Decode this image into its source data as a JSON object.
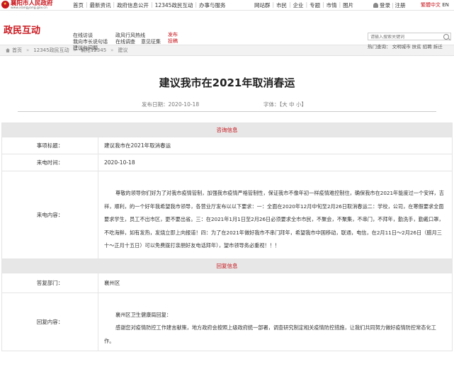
{
  "site": {
    "logo_cn": "襄阳市人民政府",
    "logo_url": "www.xiangyang.gov.cn"
  },
  "topnav": [
    "首页",
    "最新资讯",
    "政府信息公开",
    "12345政民互动",
    "办事与服务"
  ],
  "toplinks": [
    "网站群",
    "市民",
    "企业",
    "专题",
    "市情",
    "图片"
  ],
  "login": {
    "login": "登录",
    "register": "注册"
  },
  "lang": {
    "active": "繁體中文",
    "en": "EN"
  },
  "brand": "政民互动",
  "subnav": {
    "row1": [
      "在线访谈",
      "政风行风热线"
    ],
    "row2": [
      "我向市长说句话",
      "在线调查",
      "意见征集"
    ],
    "row3": [
      "建议与问题"
    ]
  },
  "hot": [
    "发布",
    "投稿"
  ],
  "search": {
    "placeholder": "请输入搜索关键词"
  },
  "hotwords": "热门查询：  文明城市 扶贫 招聘 拆迁",
  "breadcrumb": [
    "首页",
    "12345政民互动",
    "襄阳12345",
    "建议"
  ],
  "page_title": "建议我市在2021年取消春运",
  "meta": {
    "date": "发布日期：2020-10-18",
    "font": "字体：【大 中 小】"
  },
  "consult": {
    "section": "咨询信息",
    "subject_label": "事项标题：",
    "subject": "建议我市在2021年取消春运",
    "time_label": "来电时间：",
    "time": "2020-10-18",
    "content_label": "来电内容：",
    "content": "尊敬的领导你们好为了对我市疫情管制，加强我市疫情严格管制性，保证我市不像年初一样疫情难控制住，确保我市在2021年能度过一个安祥，吉祥，顺利，的一个好年我希望我市领导，各营业厅发布以以下要求：一：全面在2020年12月中旬至2月26日取消春运二：学校，公司，在寒假要求全面要求学生，员工不出市区，更不要出省。三：在2021年1月1日至2月26日必须要求全市市民，不聚会，不聚集，不串门，不拜年，勤洗手，勤戴口罩，不吃海鲜，如有发热，发烧立即上向报道！四：为了在2021年做好我市不串门拜年，希望我市中国移动，联通，电信，在2月11日～2月26日（腊月三十～正月十五日）可以免费拨打亲朋好友电话拜年），望市领导务必重视！！！"
  },
  "reply": {
    "section": "回复信息",
    "dept_label": "答复部门：",
    "dept": "襄州区",
    "content_label": "回复内容：",
    "line1": "襄州区卫生健康局回复：",
    "line2": "感谢您对疫情防控工作建言献策，地方政府会按照上级政府统一部署，调查研究制定相关疫情防控措施，让我们共同努力做好疫情防控常态化工作。"
  }
}
